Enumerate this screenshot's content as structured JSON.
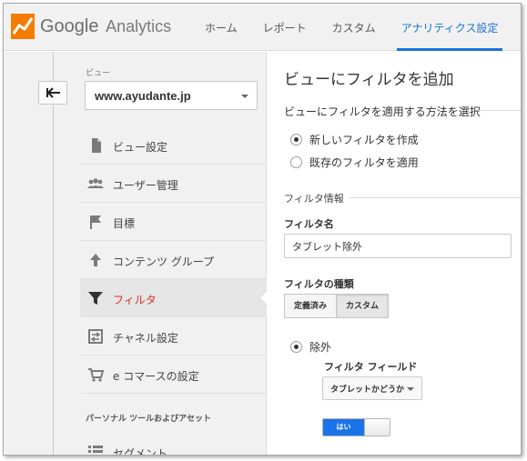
{
  "app": {
    "brand": "Google",
    "product": "Analytics",
    "accent": "#1a73d9",
    "logo_color": "#f57c00"
  },
  "nav": {
    "items": [
      {
        "label": "ホーム"
      },
      {
        "label": "レポート"
      },
      {
        "label": "カスタム"
      },
      {
        "label": "アナリティクス設定",
        "active": true
      }
    ]
  },
  "sidebar": {
    "view_label": "ビュー",
    "view_value": "www.ayudante.jp",
    "items": [
      {
        "label": "ビュー設定",
        "icon": "document-icon"
      },
      {
        "label": "ユーザー管理",
        "icon": "users-icon"
      },
      {
        "label": "目標",
        "icon": "flag-icon"
      },
      {
        "label": "コンテンツ グループ",
        "icon": "content-group-icon"
      },
      {
        "label": "フィルタ",
        "icon": "filter-icon",
        "active": true
      },
      {
        "label": "チャネル設定",
        "icon": "channel-settings-icon"
      },
      {
        "label": "e コマースの設定",
        "icon": "cart-icon"
      }
    ],
    "section_label": "パーソナル ツールおよびアセット",
    "segment_label": "セグメント"
  },
  "main": {
    "title": "ビューにフィルタを追加",
    "apply_method_heading": "ビューにフィルタを適用する方法を選択",
    "radio_new": "新しいフィルタを作成",
    "radio_existing": "既存のフィルタを適用",
    "selected_method": "new",
    "filter_info_heading": "フィルタ情報",
    "filter_name_label": "フィルタ名",
    "filter_name_value": "タブレット除外",
    "filter_type_label": "フィルタの種類",
    "filter_type_predefined": "定義済み",
    "filter_type_custom": "カスタム",
    "filter_type_selected": "custom",
    "exclude_label": "除外",
    "filter_field_label": "フィルタ フィールド",
    "filter_field_value": "タブレットかどうか",
    "toggle_label": "はい",
    "toggle_on": true
  }
}
